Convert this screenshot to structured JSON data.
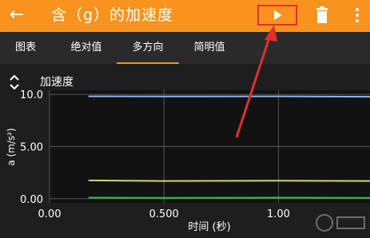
{
  "app": {
    "title": "含（g）的加速度",
    "back_icon": "arrow-left-icon",
    "play_icon": "play-icon",
    "delete_icon": "trash-icon",
    "more_icon": "more-vertical-icon",
    "accent": "#f7931e",
    "highlight_box_color": "#e0302a"
  },
  "tabs": [
    {
      "label": "图表"
    },
    {
      "label": "绝对值"
    },
    {
      "label": "多方向"
    },
    {
      "label": "简明值"
    }
  ],
  "active_tab": "多方向",
  "chart_data": {
    "type": "line",
    "title": "加速度",
    "xlabel": "时间 (秒)",
    "ylabel": "a (m/s²)",
    "x_ticks": [
      "0.00",
      "0.500",
      "1.00"
    ],
    "y_ticks": [
      "10.0",
      "5.00",
      "0.00"
    ],
    "xlim": [
      0,
      1.4
    ],
    "ylim": [
      -0.4,
      10.4
    ],
    "grid": true,
    "series": [
      {
        "color": "#8ab4f8",
        "x": [
          0.17,
          0.5,
          1.0,
          1.4
        ],
        "y": [
          9.82,
          9.8,
          9.82,
          9.78
        ]
      },
      {
        "color": "#d4d46a",
        "x": [
          0.17,
          0.5,
          1.0,
          1.4
        ],
        "y": [
          1.75,
          1.7,
          1.72,
          1.7
        ]
      },
      {
        "color": "#3fb950",
        "x": [
          0.17,
          0.5,
          1.0,
          1.4
        ],
        "y": [
          0.1,
          0.08,
          0.1,
          0.08
        ]
      }
    ]
  },
  "watermark": "watermark-logo"
}
